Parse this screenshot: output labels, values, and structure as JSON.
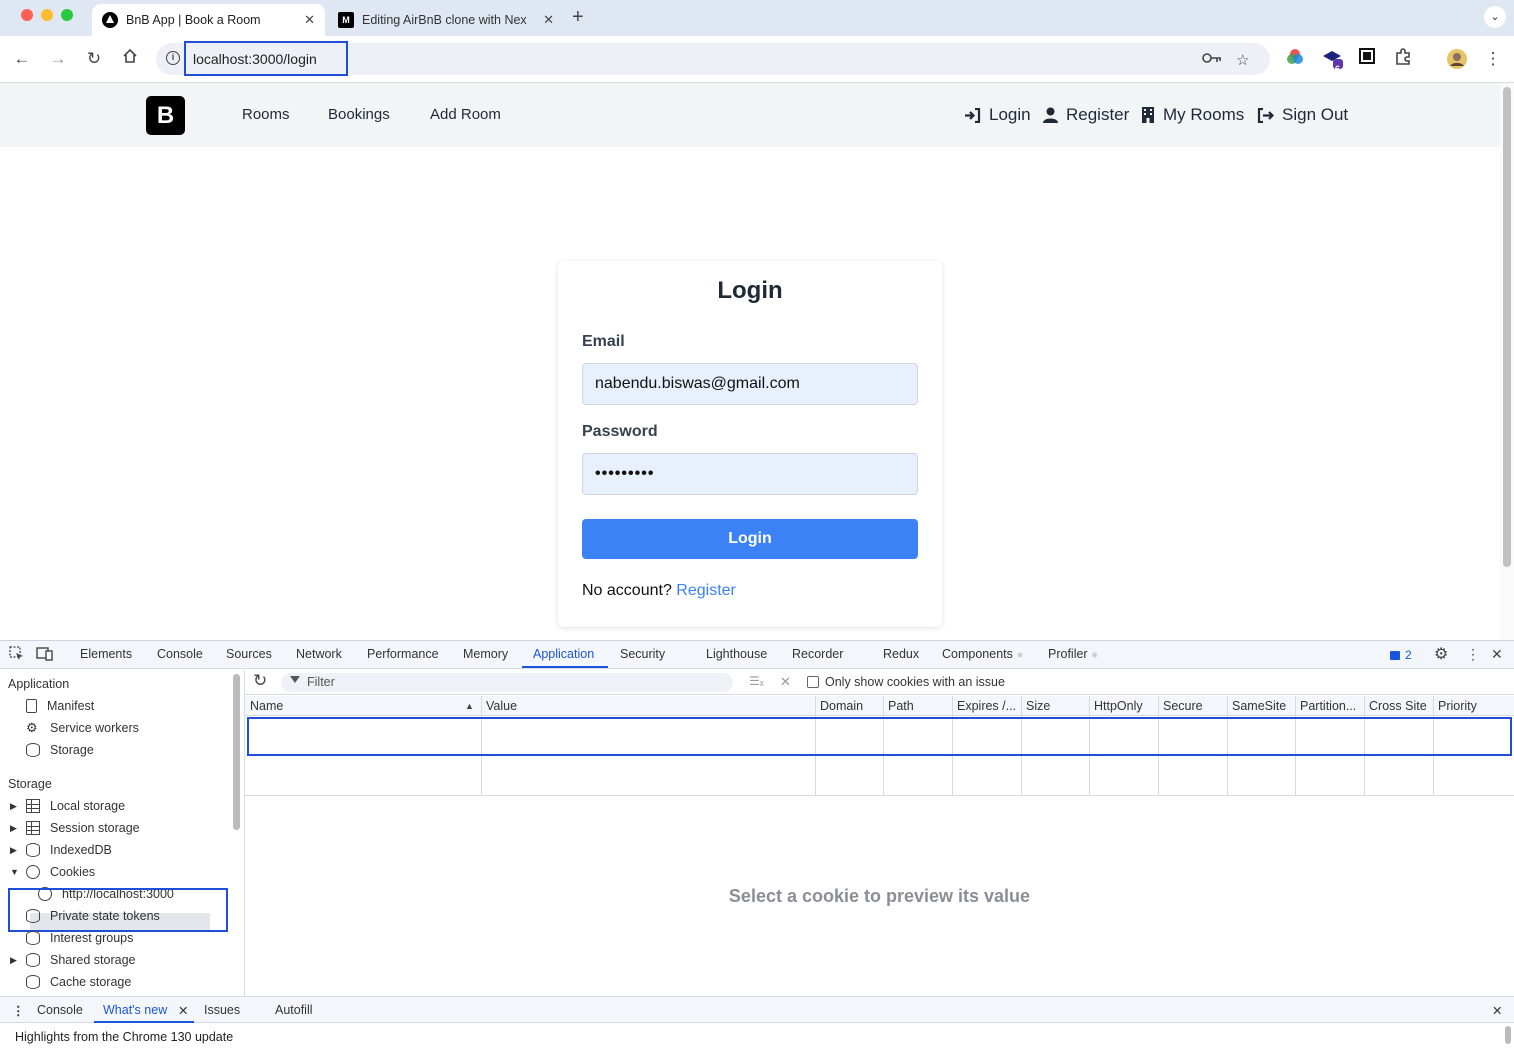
{
  "browser": {
    "tabs": [
      {
        "title": "BnB App | Book a Room",
        "active": true
      },
      {
        "title": "Editing AirBnB clone with Nex",
        "active": false
      }
    ],
    "tab2_favicon": "M",
    "url": "localhost:3000/login",
    "extension_badge": "6"
  },
  "site": {
    "logo": "B",
    "nav_left": [
      "Rooms",
      "Bookings",
      "Add Room"
    ],
    "nav_right": [
      "Login",
      "Register",
      "My Rooms",
      "Sign Out"
    ]
  },
  "login_form": {
    "title": "Login",
    "email_label": "Email",
    "email_value": "nabendu.biswas@gmail.com",
    "password_label": "Password",
    "password_value": "•••••••••",
    "submit_label": "Login",
    "no_account_text": "No account?",
    "register_link": "Register"
  },
  "devtools": {
    "tabs": [
      "Elements",
      "Console",
      "Sources",
      "Network",
      "Performance",
      "Memory",
      "Application",
      "Security",
      "Lighthouse",
      "Recorder",
      "Redux",
      "Components",
      "Profiler"
    ],
    "active_tab": "Application",
    "issues_count": "2",
    "sidebar": {
      "application_heading": "Application",
      "application_items": [
        "Manifest",
        "Service workers",
        "Storage"
      ],
      "storage_heading": "Storage",
      "storage_items": [
        "Local storage",
        "Session storage",
        "IndexedDB",
        "Cookies",
        "http://localhost:3000",
        "Private state tokens",
        "Interest groups",
        "Shared storage",
        "Cache storage"
      ]
    },
    "cookies": {
      "filter_placeholder": "Filter",
      "only_issue_label": "Only show cookies with an issue",
      "columns": [
        "Name",
        "Value",
        "Domain",
        "Path",
        "Expires /...",
        "Size",
        "HttpOnly",
        "Secure",
        "SameSite",
        "Partition...",
        "Cross Site",
        "Priority"
      ],
      "rows": [],
      "preview_message": "Select a cookie to preview its value"
    },
    "drawer": {
      "tabs": [
        "Console",
        "What's new",
        "Issues",
        "Autofill"
      ],
      "active_tab": "What's new",
      "content": "Highlights from the Chrome 130 update"
    }
  },
  "colors": {
    "accent": "#3b82f6",
    "devtools_accent": "#1a56db",
    "highlight_box": "#1f4fd6"
  }
}
